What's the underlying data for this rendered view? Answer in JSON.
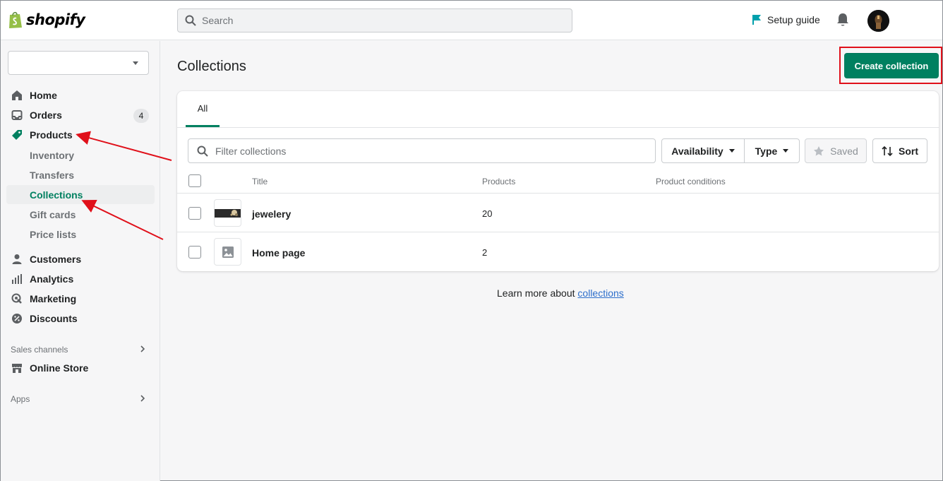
{
  "app": {
    "logo_text": "shopify"
  },
  "header": {
    "search_placeholder": "Search",
    "setup_guide_label": "Setup guide"
  },
  "sidebar": {
    "store_value": "",
    "items": [
      {
        "label": "Home",
        "icon": "home-icon"
      },
      {
        "label": "Orders",
        "icon": "orders-icon",
        "badge": "4"
      },
      {
        "label": "Products",
        "icon": "tag-icon"
      },
      {
        "label": "Customers",
        "icon": "person-icon"
      },
      {
        "label": "Analytics",
        "icon": "bar-chart-icon"
      },
      {
        "label": "Marketing",
        "icon": "marketing-icon"
      },
      {
        "label": "Discounts",
        "icon": "discount-icon"
      }
    ],
    "product_subitems": [
      "Inventory",
      "Transfers",
      "Collections",
      "Gift cards",
      "Price lists"
    ],
    "sales_channels_label": "Sales channels",
    "online_store_label": "Online Store",
    "apps_label": "Apps"
  },
  "main": {
    "title": "Collections",
    "create_button_label": "Create collection",
    "tab_all_label": "All",
    "filter_placeholder": "Filter collections",
    "filters": {
      "availability_label": "Availability",
      "type_label": "Type",
      "saved_label": "Saved",
      "sort_label": "Sort"
    },
    "table": {
      "headers": [
        "Title",
        "Products",
        "Product conditions"
      ],
      "rows": [
        {
          "title": "jewelery",
          "products": "20",
          "conditions": ""
        },
        {
          "title": "Home page",
          "products": "2",
          "conditions": ""
        }
      ]
    },
    "learn_more_text": "Learn more about",
    "learn_more_link": "collections"
  },
  "colors": {
    "primary_green": "#008060",
    "highlight_red": "#e0101a",
    "link_blue": "#2c6ecb",
    "setup_flag": "#00a0ac"
  }
}
